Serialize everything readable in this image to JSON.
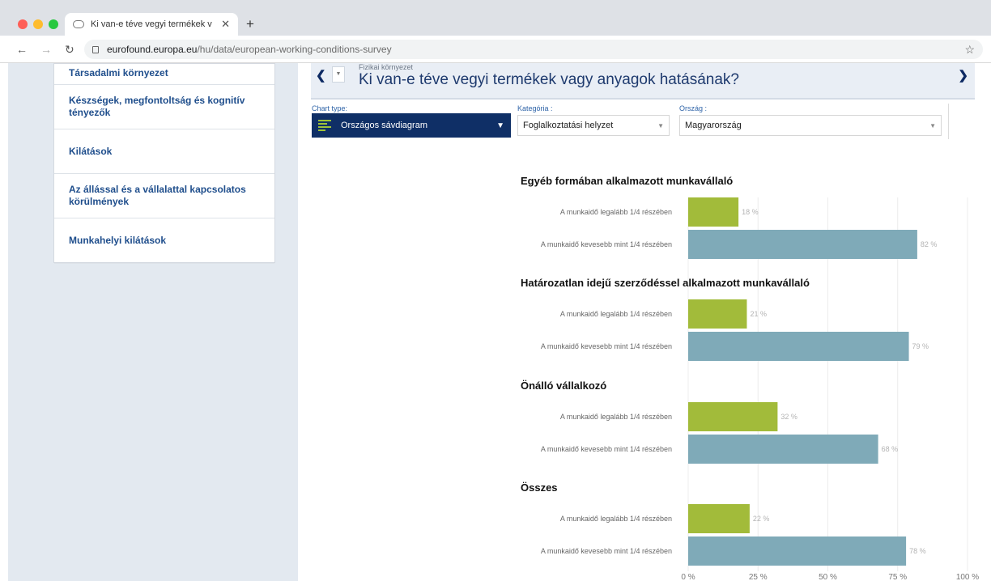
{
  "browser": {
    "tab_title": "Ki van-e téve vegyi termékek v",
    "url_host": "eurofound.europa.eu",
    "url_path": "/hu/data/european-working-conditions-survey"
  },
  "sidebar": {
    "items": [
      {
        "label": "Társadalmi környezet"
      },
      {
        "label": "Készségek, megfontoltság és kognitív tényezők"
      },
      {
        "label": "Kilátások"
      },
      {
        "label": "Az állással és a vállalattal kapcsolatos körülmények"
      },
      {
        "label": "Munkahelyi kilátások"
      }
    ]
  },
  "question": {
    "category": "Fizikai környezet",
    "title": "Ki van-e téve vegyi termékek vagy anyagok hatásának?"
  },
  "controls": {
    "chart_type_label": "Chart type:",
    "chart_type_value": "Országos sávdiagram",
    "category_label": "Kategória :",
    "category_value": "Foglalkoztatási helyzet",
    "country_label": "Ország :",
    "country_value": "Magyarország"
  },
  "colors": {
    "accent_green": "#a2bb3a",
    "bar_blue": "#7faab8",
    "nav_dark": "#0f2f66",
    "link_blue": "#1f4e8c"
  },
  "chart_data": {
    "type": "bar",
    "orientation": "horizontal",
    "xlim": [
      0,
      100
    ],
    "x_ticks": [
      "0 %",
      "25 %",
      "50 %",
      "75 %",
      "100 %"
    ],
    "categories": [
      "A munkaidő legalább 1/4 részében",
      "A munkaidő kevesebb mint 1/4 részében"
    ],
    "groups": [
      {
        "title": "Egyéb formában alkalmazott munkavállaló",
        "values": [
          18,
          82
        ],
        "labels": [
          "18 %",
          "82 %"
        ]
      },
      {
        "title": "Határozatlan idejű szerződéssel alkalmazott munkavállaló",
        "values": [
          21,
          79
        ],
        "labels": [
          "21 %",
          "79 %"
        ]
      },
      {
        "title": "Önálló vállalkozó",
        "values": [
          32,
          68
        ],
        "labels": [
          "32 %",
          "68 %"
        ]
      },
      {
        "title": "Összes",
        "values": [
          22,
          78
        ],
        "labels": [
          "22 %",
          "78 %"
        ]
      }
    ],
    "series_colors": [
      "#a2bb3a",
      "#7faab8"
    ],
    "grid": true
  }
}
